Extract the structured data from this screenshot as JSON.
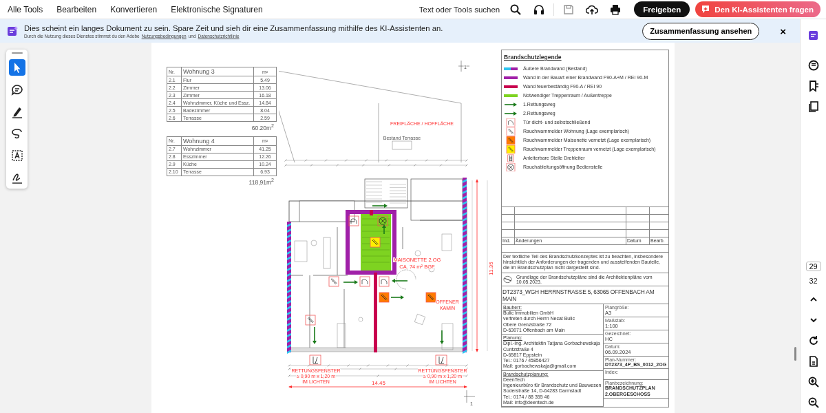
{
  "menu": [
    {
      "label": "Alle Tools"
    },
    {
      "label": "Bearbeiten"
    },
    {
      "label": "Konvertieren"
    },
    {
      "label": "Elektronische Signaturen"
    }
  ],
  "search": {
    "label": "Text oder Tools suchen"
  },
  "share_button": "Freigeben",
  "ai_button": "Den KI-Assistenten fragen",
  "banner": {
    "message": "Dies scheint ein langes Dokument zu sein. Spare Zeit und sieh dir eine Zusammenfassung mithilfe des KI-Assistenten an.",
    "note": "Durch die Nutzung dieses Dienstes stimmst du den Adobe",
    "links": [
      "Nutzungsbedingungen",
      "Datenschutzrichtlinie"
    ],
    "conjunction": "und",
    "button": "Zusammenfassung ansehen",
    "close": "×"
  },
  "tools": [
    {
      "kind": "select",
      "selected": true
    },
    {
      "kind": "comment",
      "selected": false
    },
    {
      "kind": "draw",
      "selected": false
    },
    {
      "kind": "lasso",
      "selected": false
    },
    {
      "kind": "textbox",
      "selected": false
    },
    {
      "kind": "sign",
      "selected": false
    }
  ],
  "page_nav": {
    "current": "29",
    "total": "32"
  },
  "document": {
    "area_tables": [
      {
        "header": [
          "Nr.",
          "Wohnung  3",
          "m²"
        ],
        "rows": [
          [
            "2.1",
            "Flur",
            "5.49"
          ],
          [
            "2.2",
            "Zimmer",
            "13.06"
          ],
          [
            "2.3",
            "Zimmer",
            "16.18"
          ],
          [
            "2.4",
            "Wohnzimmer, Küche und Essz.",
            "14.84"
          ],
          [
            "2.5",
            "Badezimmer",
            "8.04"
          ],
          [
            "2.6",
            "Terrasse",
            "2.59"
          ]
        ],
        "total": "60.20m$^{2}$"
      },
      {
        "header": [
          "Nr.",
          "Wohnung  4",
          "m²"
        ],
        "rows": [
          [
            "2.7",
            "Wohnzimmer",
            "41.25"
          ],
          [
            "2.8",
            "Esszimmer",
            "12.26"
          ],
          [
            "2.9",
            "Küche",
            "10.24"
          ],
          [
            "2.10",
            "Terrasse",
            "6.93"
          ]
        ],
        "total": "118,91m$^{2}$"
      }
    ],
    "plan": {
      "outdoor_label": "FREIFLÄCHE / HOFFLÄCHE",
      "terrace_label": "Bestand Terrasse",
      "unit_label": [
        "MAISONETTE 2.OG",
        "CA. 74 m² BGF"
      ],
      "fireplace_label": [
        "OFFENER",
        "KAMIN"
      ],
      "rescue_windows": [
        {
          "lines": [
            "RETTUNGSFENSTER",
            "≥ 0,90 m x 1,20 m",
            "IM LICHTEN"
          ]
        },
        {
          "lines": [
            "RETTUNGSFENSTER",
            "≥ 0,90 m x 1,20 m",
            "IM LICHTEN"
          ]
        }
      ],
      "width_dimension": "14.45",
      "depth_dimension": "11.35",
      "section_marks": [
        "1",
        "1"
      ]
    },
    "legend": {
      "title": "Brandschutzlegende",
      "items": [
        {
          "kind": "striped-wall",
          "label": "Äußere Brandwand (Bestand)"
        },
        {
          "kind": "wall",
          "color": "#a020a8",
          "label": "Wand in der Bauart einer Brandwand F90-A+M / REI 90-M"
        },
        {
          "kind": "wall",
          "color": "#c8004e",
          "label": "Wand feuerbeständig F90-A / REI 90"
        },
        {
          "kind": "wall",
          "color": "#7ed321",
          "label": "Notwendiger Treppenraum / Außentreppe"
        },
        {
          "kind": "arrow",
          "label": "1.Rettungsweg"
        },
        {
          "kind": "arrow",
          "label": "2.Rettungsweg"
        },
        {
          "kind": "door",
          "label": "Tür dicht- und selbstschließend"
        },
        {
          "kind": "detector",
          "label": "Rauchwarnmelder Wohnung (Lage exemplarisch)"
        },
        {
          "kind": "detector",
          "color": "#ff7a00",
          "label": "Rauchwarnmelder Maisonette vernetzt (Lage exemplarisch)"
        },
        {
          "kind": "detector",
          "color": "#ffee00",
          "label": "Rauchwarnmelder Treppenraum vernetzt (Lage exemplarisch)"
        },
        {
          "kind": "ladder",
          "label": "Anleiterbare Stelle Drehleiter"
        },
        {
          "kind": "vent",
          "label": "Rauchableitungsöffnung Bedienstelle"
        }
      ]
    },
    "title_block": {
      "changes_header": [
        "Ind.",
        "Änderungen",
        "Datum",
        "Bearb."
      ],
      "note": "Der textliche Teil des Brandschutzkonzeptes ist zu beachten, insbesondere hinsichtlich der Anforderungen der tragenden und aussteifenden Bauteile, die im Brandschutzplan nicht dargestellt sind.",
      "basis": "Grundlage der Brandschutzpläne sind die Architektenpläne vom 10.05.2023.",
      "project": "DT2373_WGH HERRNSTRASSE 5, 63065 OFFENBACH AM MAIN",
      "parties": [
        {
          "heading": "Bauherr:",
          "lines": [
            "Bulic Immobilien GmbH",
            "vertreten durch Herrn Necat Bulic",
            "Obere Grenzstraße 72",
            "D-63071 Offenbach am Main"
          ]
        },
        {
          "heading": "Planung:",
          "lines": [
            "Dipl.-Ing. Architektin Tatjana Gorbachewskaja",
            "Cuntzstraße 4",
            "D-65817 Eppstein",
            "Tel.: 0176 / 45856427",
            "Mail: gorbachewskaja@gmail.com"
          ]
        },
        {
          "heading": "Brandschutzplanung:",
          "lines": [
            "DeenTech",
            "Ingenieurbüro für Brandschutz und Bauwesen",
            "Soderstraße 14, D-64283 Darmstadt",
            "Tel.: 0174 / 88 355 46",
            "Mail: info@deentech.de"
          ]
        }
      ],
      "fields": [
        {
          "label": "Plangröße:",
          "lines": [
            "A3"
          ]
        },
        {
          "label": "Maßstab:",
          "lines": [
            "1:100"
          ]
        },
        {
          "label": "Gezeichnet:",
          "lines": [
            "HC"
          ]
        },
        {
          "label": "Datum:",
          "lines": [
            "06.09.2024"
          ]
        },
        {
          "label": "Plan-Nummer:",
          "lines": [
            "DT2373_4P_BS_0012_2OG"
          ]
        },
        {
          "label": "Index:"
        },
        {
          "label": "Planbezeichnung:",
          "lines": [
            "BRANDSCHUTZPLAN",
            "2.OBERGESCHOSS"
          ]
        }
      ]
    }
  }
}
